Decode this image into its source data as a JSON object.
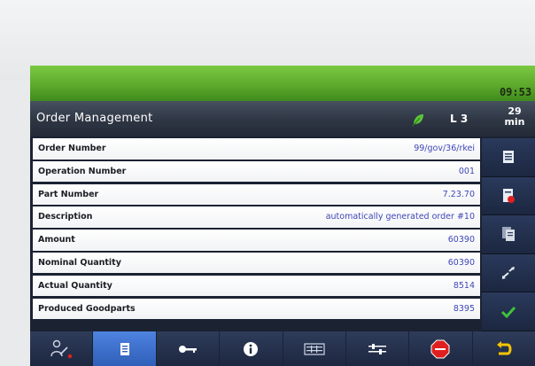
{
  "status_bar": {
    "clock": "09:53",
    "accent_color": "#6bb939"
  },
  "title_bar": {
    "title": "Order Management",
    "line": "L 3",
    "time_value": "29",
    "time_unit": "min",
    "leaf_icon": "leaf-icon"
  },
  "fields": [
    {
      "label": "Order Number",
      "value": "99/gov/36/rkei"
    },
    {
      "label": "Operation Number",
      "value": "001"
    },
    {
      "label": "Part Number",
      "value": "7.23.70"
    },
    {
      "label": "Description",
      "value": "automatically generated order #10"
    },
    {
      "label": "Amount",
      "value": "60390"
    },
    {
      "label": "Nominal Quantity",
      "value": "60390"
    },
    {
      "label": "Actual Quantity",
      "value": "8514"
    },
    {
      "label": "Produced Goodparts",
      "value": "8395"
    }
  ],
  "side_actions": [
    {
      "icon": "order-list-icon"
    },
    {
      "icon": "order-stop-icon"
    },
    {
      "icon": "copy-documents-icon"
    },
    {
      "icon": "expand-arrows-icon"
    },
    {
      "icon": "confirm-check-icon"
    }
  ],
  "bottom_nav": [
    {
      "icon": "user-tools-icon",
      "selected": false
    },
    {
      "icon": "document-icon",
      "selected": true
    },
    {
      "icon": "key-icon",
      "selected": false
    },
    {
      "icon": "info-icon",
      "selected": false
    },
    {
      "icon": "panel-icon",
      "selected": false
    },
    {
      "icon": "settings-sliders-icon",
      "selected": false
    },
    {
      "icon": "stop-icon",
      "selected": false
    },
    {
      "icon": "back-arrow-icon",
      "selected": false
    }
  ],
  "colors": {
    "value_text": "#3f47b8",
    "selected_button": "#3b6fd0",
    "confirm_green": "#3fc23a",
    "stop_red": "#e02020",
    "back_yellow": "#f5c400"
  }
}
